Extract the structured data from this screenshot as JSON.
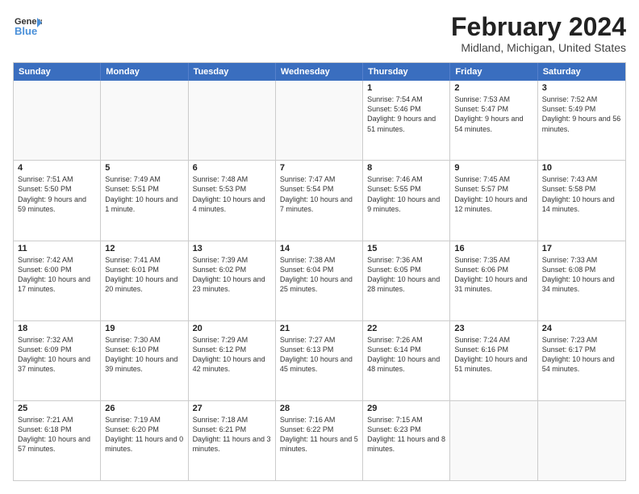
{
  "header": {
    "logo_line1": "General",
    "logo_line2": "Blue",
    "title": "February 2024",
    "subtitle": "Midland, Michigan, United States"
  },
  "days_of_week": [
    "Sunday",
    "Monday",
    "Tuesday",
    "Wednesday",
    "Thursday",
    "Friday",
    "Saturday"
  ],
  "weeks": [
    [
      {
        "day": "",
        "content": ""
      },
      {
        "day": "",
        "content": ""
      },
      {
        "day": "",
        "content": ""
      },
      {
        "day": "",
        "content": ""
      },
      {
        "day": "1",
        "content": "Sunrise: 7:54 AM\nSunset: 5:46 PM\nDaylight: 9 hours and 51 minutes."
      },
      {
        "day": "2",
        "content": "Sunrise: 7:53 AM\nSunset: 5:47 PM\nDaylight: 9 hours and 54 minutes."
      },
      {
        "day": "3",
        "content": "Sunrise: 7:52 AM\nSunset: 5:49 PM\nDaylight: 9 hours and 56 minutes."
      }
    ],
    [
      {
        "day": "4",
        "content": "Sunrise: 7:51 AM\nSunset: 5:50 PM\nDaylight: 9 hours and 59 minutes."
      },
      {
        "day": "5",
        "content": "Sunrise: 7:49 AM\nSunset: 5:51 PM\nDaylight: 10 hours and 1 minute."
      },
      {
        "day": "6",
        "content": "Sunrise: 7:48 AM\nSunset: 5:53 PM\nDaylight: 10 hours and 4 minutes."
      },
      {
        "day": "7",
        "content": "Sunrise: 7:47 AM\nSunset: 5:54 PM\nDaylight: 10 hours and 7 minutes."
      },
      {
        "day": "8",
        "content": "Sunrise: 7:46 AM\nSunset: 5:55 PM\nDaylight: 10 hours and 9 minutes."
      },
      {
        "day": "9",
        "content": "Sunrise: 7:45 AM\nSunset: 5:57 PM\nDaylight: 10 hours and 12 minutes."
      },
      {
        "day": "10",
        "content": "Sunrise: 7:43 AM\nSunset: 5:58 PM\nDaylight: 10 hours and 14 minutes."
      }
    ],
    [
      {
        "day": "11",
        "content": "Sunrise: 7:42 AM\nSunset: 6:00 PM\nDaylight: 10 hours and 17 minutes."
      },
      {
        "day": "12",
        "content": "Sunrise: 7:41 AM\nSunset: 6:01 PM\nDaylight: 10 hours and 20 minutes."
      },
      {
        "day": "13",
        "content": "Sunrise: 7:39 AM\nSunset: 6:02 PM\nDaylight: 10 hours and 23 minutes."
      },
      {
        "day": "14",
        "content": "Sunrise: 7:38 AM\nSunset: 6:04 PM\nDaylight: 10 hours and 25 minutes."
      },
      {
        "day": "15",
        "content": "Sunrise: 7:36 AM\nSunset: 6:05 PM\nDaylight: 10 hours and 28 minutes."
      },
      {
        "day": "16",
        "content": "Sunrise: 7:35 AM\nSunset: 6:06 PM\nDaylight: 10 hours and 31 minutes."
      },
      {
        "day": "17",
        "content": "Sunrise: 7:33 AM\nSunset: 6:08 PM\nDaylight: 10 hours and 34 minutes."
      }
    ],
    [
      {
        "day": "18",
        "content": "Sunrise: 7:32 AM\nSunset: 6:09 PM\nDaylight: 10 hours and 37 minutes."
      },
      {
        "day": "19",
        "content": "Sunrise: 7:30 AM\nSunset: 6:10 PM\nDaylight: 10 hours and 39 minutes."
      },
      {
        "day": "20",
        "content": "Sunrise: 7:29 AM\nSunset: 6:12 PM\nDaylight: 10 hours and 42 minutes."
      },
      {
        "day": "21",
        "content": "Sunrise: 7:27 AM\nSunset: 6:13 PM\nDaylight: 10 hours and 45 minutes."
      },
      {
        "day": "22",
        "content": "Sunrise: 7:26 AM\nSunset: 6:14 PM\nDaylight: 10 hours and 48 minutes."
      },
      {
        "day": "23",
        "content": "Sunrise: 7:24 AM\nSunset: 6:16 PM\nDaylight: 10 hours and 51 minutes."
      },
      {
        "day": "24",
        "content": "Sunrise: 7:23 AM\nSunset: 6:17 PM\nDaylight: 10 hours and 54 minutes."
      }
    ],
    [
      {
        "day": "25",
        "content": "Sunrise: 7:21 AM\nSunset: 6:18 PM\nDaylight: 10 hours and 57 minutes."
      },
      {
        "day": "26",
        "content": "Sunrise: 7:19 AM\nSunset: 6:20 PM\nDaylight: 11 hours and 0 minutes."
      },
      {
        "day": "27",
        "content": "Sunrise: 7:18 AM\nSunset: 6:21 PM\nDaylight: 11 hours and 3 minutes."
      },
      {
        "day": "28",
        "content": "Sunrise: 7:16 AM\nSunset: 6:22 PM\nDaylight: 11 hours and 5 minutes."
      },
      {
        "day": "29",
        "content": "Sunrise: 7:15 AM\nSunset: 6:23 PM\nDaylight: 11 hours and 8 minutes."
      },
      {
        "day": "",
        "content": ""
      },
      {
        "day": "",
        "content": ""
      }
    ]
  ]
}
